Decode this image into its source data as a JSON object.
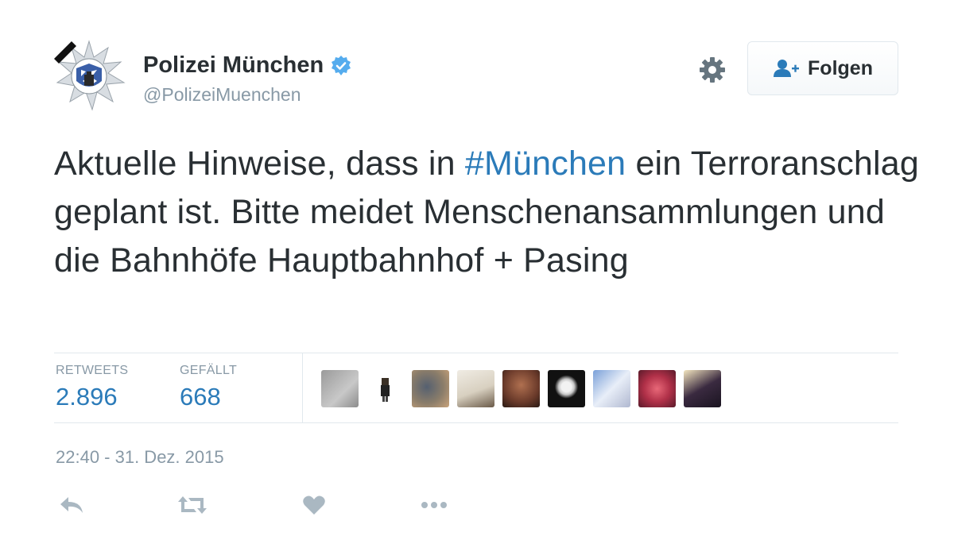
{
  "account": {
    "name": "Polizei München",
    "handle": "@PolizeiMuenchen",
    "verified_icon": "verified-badge-icon",
    "avatar_icon": "police-star-logo"
  },
  "header": {
    "follow_label": "Folgen",
    "follow_icon": "add-user-icon",
    "settings_icon": "gear-icon"
  },
  "tweet": {
    "text_before": "Aktuelle Hinweise, dass in ",
    "hashtag": "#München",
    "text_after": " ein Terroranschlag geplant ist. Bitte meidet Menschenansammlungen und die Bahnhöfe Hauptbahnhof + Pasing"
  },
  "stats": {
    "retweets_label": "RETWEETS",
    "retweets_value": "2.896",
    "likes_label": "GEFÄLLT",
    "likes_value": "668"
  },
  "timestamp": "22:40 - 31. Dez. 2015",
  "actions": [
    "reply-icon",
    "retweet-icon",
    "like-icon",
    "more-icon"
  ],
  "colors": {
    "link": "#2b7bb9",
    "muted": "#8899a6",
    "text": "#292f33",
    "verified": "#55acee",
    "border": "#e1e8ed"
  }
}
